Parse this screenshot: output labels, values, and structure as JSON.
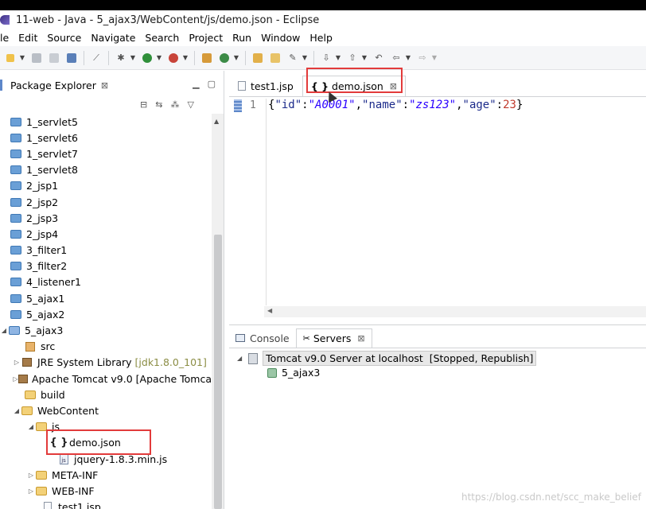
{
  "window": {
    "title": "11-web - Java - 5_ajax3/WebContent/js/demo.json - Eclipse"
  },
  "menu": [
    "le",
    "Edit",
    "Source",
    "Navigate",
    "Search",
    "Project",
    "Run",
    "Window",
    "Help"
  ],
  "package_explorer": {
    "tab_label": "Package Explorer",
    "tab_close": "⊠",
    "items": [
      {
        "label": "1_servlet5",
        "icon": "project-folder-icon",
        "depth": 0
      },
      {
        "label": "1_servlet6",
        "icon": "project-folder-icon",
        "depth": 0
      },
      {
        "label": "1_servlet7",
        "icon": "project-folder-icon",
        "depth": 0
      },
      {
        "label": "1_servlet8",
        "icon": "project-folder-icon",
        "depth": 0
      },
      {
        "label": "2_jsp1",
        "icon": "project-folder-icon",
        "depth": 0
      },
      {
        "label": "2_jsp2",
        "icon": "project-folder-icon",
        "depth": 0
      },
      {
        "label": "2_jsp3",
        "icon": "project-folder-icon",
        "depth": 0
      },
      {
        "label": "2_jsp4",
        "icon": "project-folder-icon",
        "depth": 0
      },
      {
        "label": "3_filter1",
        "icon": "project-folder-icon",
        "depth": 0
      },
      {
        "label": "3_filter2",
        "icon": "project-folder-icon",
        "depth": 0
      },
      {
        "label": "4_listener1",
        "icon": "project-folder-icon",
        "depth": 0
      },
      {
        "label": "5_ajax1",
        "icon": "project-folder-icon",
        "depth": 0
      },
      {
        "label": "5_ajax2",
        "icon": "project-folder-icon",
        "depth": 0
      },
      {
        "label": "5_ajax3",
        "icon": "project-folder-icon",
        "depth": 0,
        "expanded": true
      },
      {
        "label": "src",
        "icon": "package-icon",
        "depth": 1
      },
      {
        "label": "JRE System Library",
        "suffix": "[jdk1.8.0_101]",
        "icon": "library-icon",
        "depth": 1,
        "collapsed": true
      },
      {
        "label": "Apache Tomcat v9.0 [Apache Tomca",
        "icon": "library-icon",
        "depth": 1,
        "collapsed": true
      },
      {
        "label": "build",
        "icon": "folder-icon",
        "depth": 1
      },
      {
        "label": "WebContent",
        "icon": "folder-icon",
        "depth": 1,
        "expanded": true
      },
      {
        "label": "js",
        "icon": "folder-icon",
        "depth": 2,
        "expanded": true
      },
      {
        "label": "demo.json",
        "icon": "json-file-icon",
        "depth": 3
      },
      {
        "label": "jquery-1.8.3.min.js",
        "icon": "js-file-icon",
        "depth": 3
      },
      {
        "label": "META-INF",
        "icon": "folder-icon",
        "depth": 2,
        "collapsed": true
      },
      {
        "label": "WEB-INF",
        "icon": "folder-icon",
        "depth": 2,
        "collapsed": true
      },
      {
        "label": "test1.jsp",
        "icon": "jsp-file-icon",
        "depth": 2
      }
    ]
  },
  "editor": {
    "tabs": [
      {
        "label": "test1.jsp",
        "active": false
      },
      {
        "label": "demo.json",
        "active": true,
        "close": "⊠"
      }
    ],
    "line_number": "1",
    "code": {
      "open": "{",
      "k1": "\"id\"",
      "v1": "\"A0001\"",
      "k2": "\"name\"",
      "v2": "\"zs123\"",
      "k3": "\"age\"",
      "v3": "23",
      "colon": ":",
      "comma": ",",
      "close": "}"
    }
  },
  "servers_panel": {
    "tabs": [
      {
        "label": "Console",
        "active": false
      },
      {
        "label": "Servers",
        "active": true,
        "close": "⊠"
      }
    ],
    "server": "Tomcat v9.0 Server at localhost",
    "server_status": "[Stopped, Republish]",
    "module": "5_ajax3"
  },
  "watermark": "https://blog.csdn.net/scc_make_belief",
  "colors": {
    "highlight_box": "#e23b3b",
    "selection": "#e8e8e8"
  }
}
